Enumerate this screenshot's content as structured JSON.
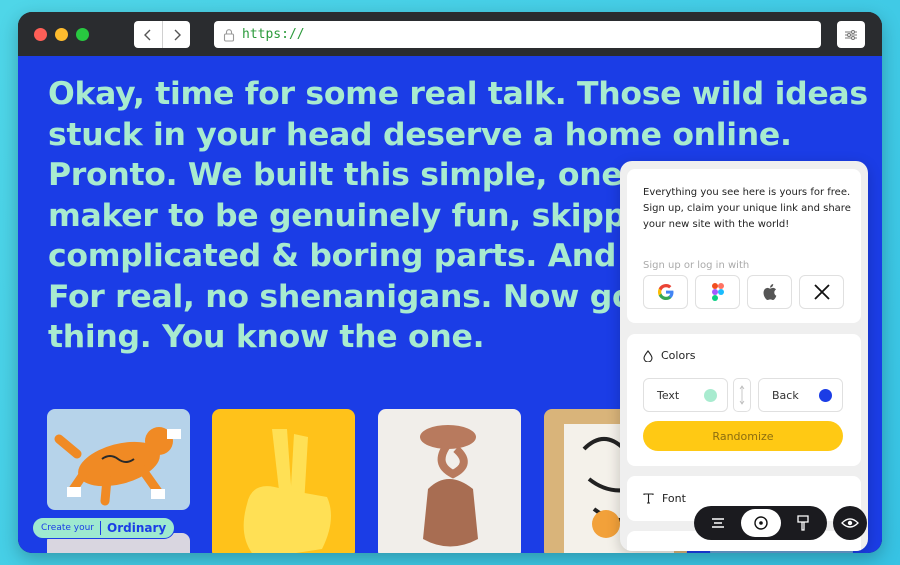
{
  "browser": {
    "url": "https://",
    "back_icon": "chevron-left-icon",
    "forward_icon": "chevron-right-icon",
    "menu_icon": "sliders-icon"
  },
  "page": {
    "headline": "Okay, time for some real talk. Those wild ideas stuck in your head deserve a home online. Pronto. We built this simple, one-page site maker to be genuinely fun, skipping all the complicated & boring parts. And yes, it's free. For real, no shenanigans. Now go build that thing. You know the one.",
    "background_color": "#1b3de6",
    "headline_color": "#a8ebcf",
    "badge": {
      "prefix": "Create your",
      "brand": "Ordinary"
    }
  },
  "panel": {
    "intro": "Everything you see here is yours for free. Sign up, claim your unique link and share your new site with the world!",
    "signin_label": "Sign up or log in with",
    "providers": [
      "google-icon",
      "figma-icon",
      "apple-icon",
      "x-icon"
    ],
    "colors": {
      "title": "Colors",
      "text_label": "Text",
      "text_color": "#a8ebcf",
      "back_label": "Back",
      "back_color": "#1b3de6",
      "randomize_label": "Randomize"
    },
    "font": {
      "title": "Font"
    }
  },
  "toolbar": {
    "items": [
      "align-icon",
      "target-icon",
      "brush-icon"
    ],
    "active": "target-icon",
    "eye": "eye-icon"
  }
}
